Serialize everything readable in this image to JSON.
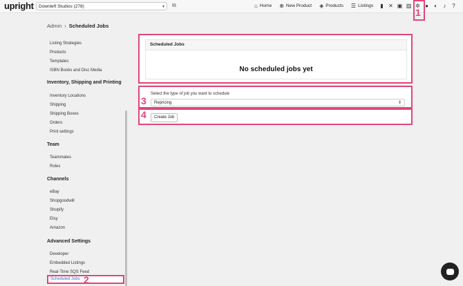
{
  "topbar": {
    "logo": "upright",
    "store": "Downleft Studios (278)",
    "nav": [
      {
        "icon": "home-icon",
        "glyph": "⌂",
        "label": "Home"
      },
      {
        "icon": "plus-circle-icon",
        "glyph": "⊕",
        "label": "New Product"
      },
      {
        "icon": "products-icon",
        "glyph": "◈",
        "label": "Products"
      },
      {
        "icon": "listings-icon",
        "glyph": "☰",
        "label": "Listings"
      }
    ]
  },
  "breadcrumb": {
    "root": "Admin",
    "sep": "›",
    "current": "Scheduled Jobs"
  },
  "sidebar": {
    "sections": [
      {
        "title": "Inventory, Shipping and Printing"
      },
      {
        "title": "Team"
      },
      {
        "title": "Channels"
      },
      {
        "title": "Advanced Settings"
      }
    ],
    "items_top": [
      "Listing Strategies",
      "Products",
      "Templates",
      "ISBN Books and Disc Media"
    ],
    "items_inventory": [
      "Inventory Locations",
      "Shipping",
      "Shipping Boxes",
      "Orders",
      "Print settings"
    ],
    "items_team": [
      "Teammates",
      "Roles"
    ],
    "items_channels": [
      "eBay",
      "Shopgoodwill",
      "Shopify",
      "Etsy",
      "Amazon"
    ],
    "items_advanced": [
      "Developer",
      "Embedded Listings",
      "Real-Time SQS Feed"
    ],
    "active": "Scheduled Jobs"
  },
  "main": {
    "panel_title": "Scheduled Jobs",
    "empty_text": "No scheduled jobs yet",
    "select_label": "Select the type of job you want to schedule",
    "select_value": "Repricing",
    "create_button": "Create Job"
  },
  "callouts": [
    "1",
    "2",
    "3",
    "4"
  ],
  "colors": {
    "highlight": "#e0457b",
    "link": "#2b6ad6"
  }
}
